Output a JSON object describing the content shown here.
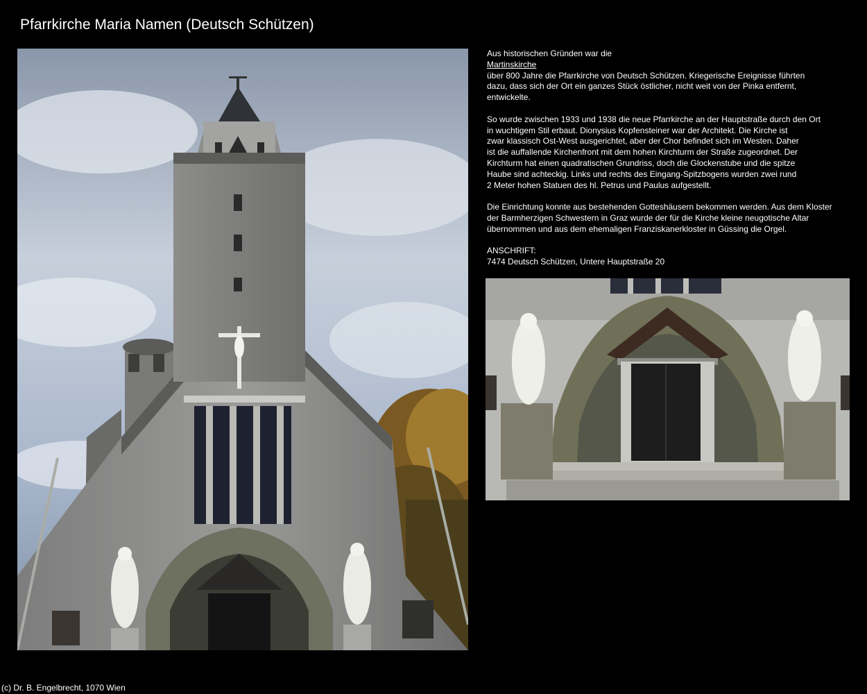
{
  "page": {
    "title": "Pfarrkirche Maria Namen (Deutsch Schützen)"
  },
  "description": {
    "para1_intro": "Aus historischen Gründen war die",
    "para1_link": "Martinskirche",
    "para1_lines": [
      "über 800 Jahre die Pfarrkirche von Deutsch Schützen. Kriegerische Ereignisse führten",
      "dazu, dass sich der Ort ein ganzes Stück östlicher, nicht weit von der Pinka entfernt,",
      "entwickelte."
    ],
    "para2_lines": [
      "So wurde zwischen 1933 und 1938 die neue Pfarrkirche an der Hauptstraße durch den Ort",
      "in wuchtigem Stil erbaut. Dionysius Kopfensteiner war der Architekt. Die Kirche ist",
      "zwar klassisch Ost-West ausgerichtet, aber der Chor befindet sich im Westen. Daher",
      "ist die auffallende Kirchenfront mit dem hohen Kirchturm der Straße zugeordnet. Der",
      "Kirchturm hat einen quadratischen Grundriss, doch die Glockenstube und die spitze",
      "Haube sind achteckig. Links und rechts des Eingang-Spitzbogens wurden zwei rund",
      "2 Meter hohen Statuen des hl. Petrus und Paulus aufgestellt."
    ],
    "para3_lines": [
      "Die Einrichtung konnte aus bestehenden Gotteshäusern bekommen werden. Aus dem Kloster",
      "der Barmherzigen Schwestern in Graz wurde der für die Kirche kleine neugotische Altar",
      "übernommen und aus dem ehemaligen Franziskanerkloster in Güssing die Orgel."
    ],
    "address_label": "ANSCHRIFT:",
    "address_value": "7474 Deutsch Schützen, Untere Hauptstraße 20"
  },
  "footer": {
    "copyright": "(c) Dr. B. Engelbrecht, 1070 Wien"
  },
  "colors": {
    "background": "#000000",
    "text": "#ffffff"
  }
}
